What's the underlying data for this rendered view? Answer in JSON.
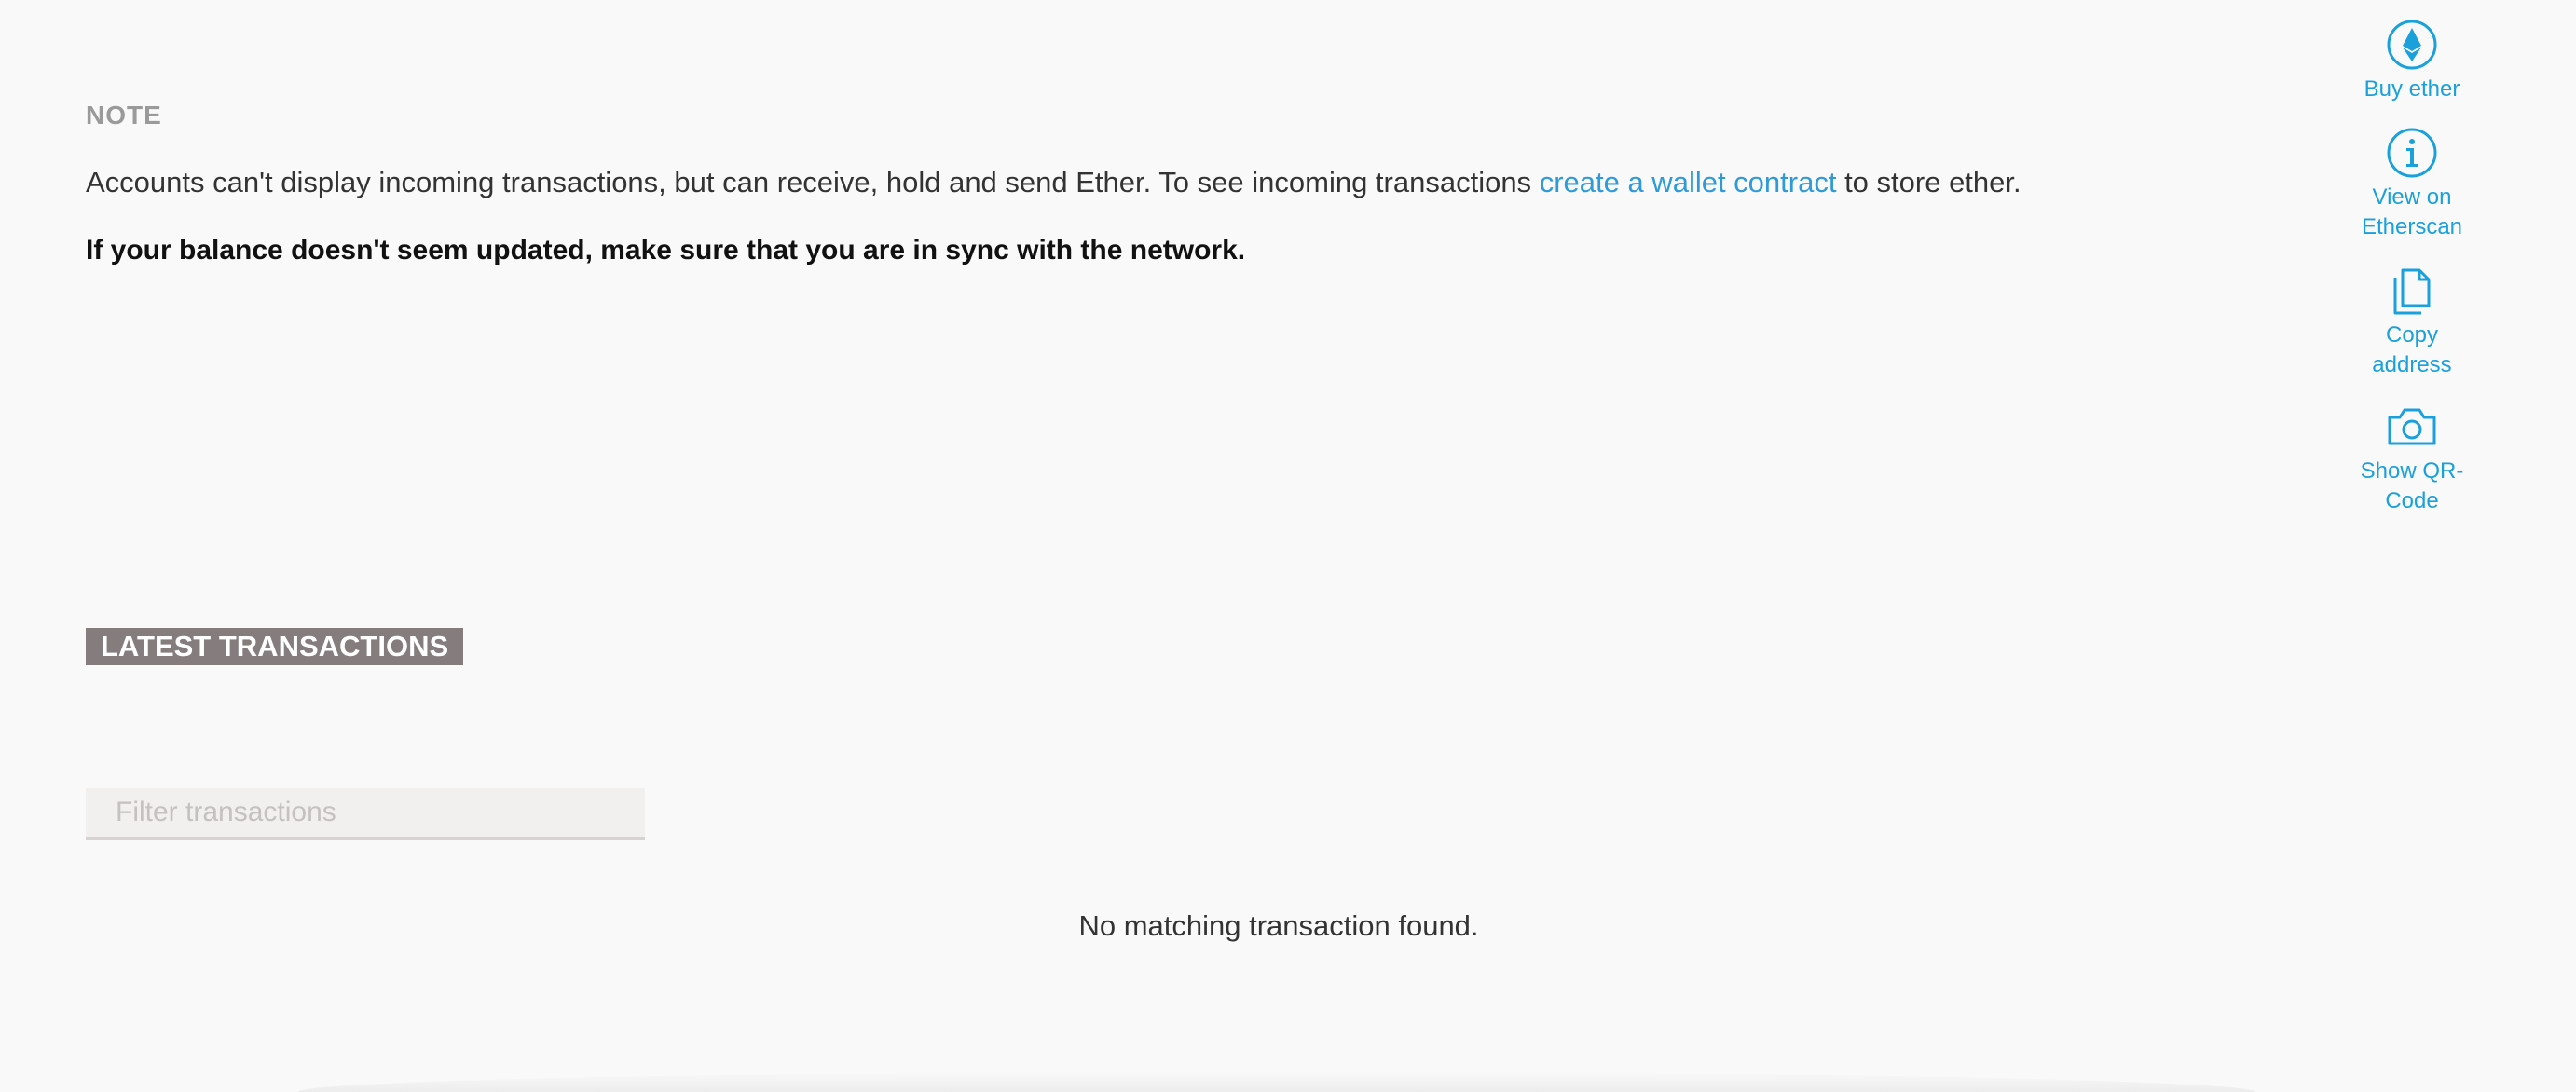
{
  "note": {
    "heading": "NOTE",
    "body_prefix": "Accounts can't display incoming transactions, but can receive, hold and send Ether. To see incoming transactions ",
    "link_text": "create a wallet contract",
    "body_suffix": " to store ether.",
    "bold_text": "If your balance doesn't seem updated, make sure that you are in sync with the network."
  },
  "actions": [
    {
      "label": "Buy ether",
      "icon": "ether-icon"
    },
    {
      "label": "View on Etherscan",
      "icon": "info-icon"
    },
    {
      "label": "Copy address",
      "icon": "copy-icon"
    },
    {
      "label": "Show QR-Code",
      "icon": "camera-icon"
    }
  ],
  "transactions": {
    "title": "LATEST TRANSACTIONS",
    "filter_placeholder": "Filter transactions",
    "filter_value": "",
    "empty_message": "No matching transaction found."
  },
  "colors": {
    "accent": "#1aa0db",
    "link": "#2e9ad7",
    "section_title_bg": "#857d7d",
    "background": "#f9f9f9"
  }
}
